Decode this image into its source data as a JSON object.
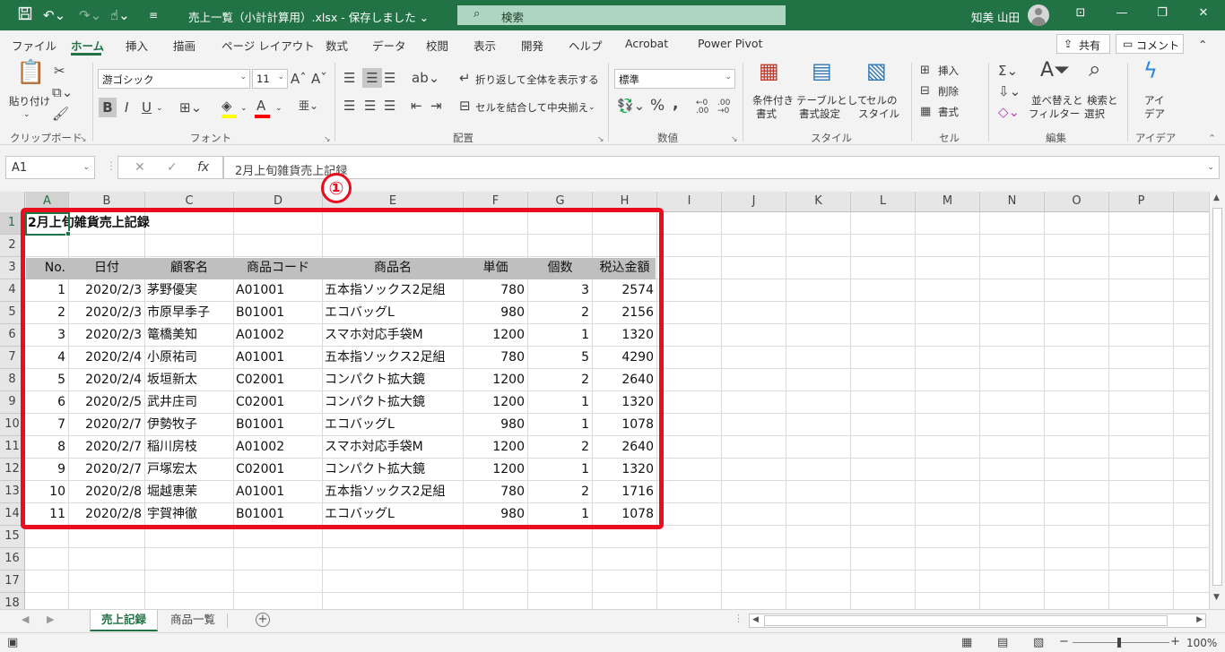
{
  "titlebar": {
    "doc_title": "売上一覧（小計計算用）.xlsx - 保存しました ⌄",
    "search_icon": "search-icon",
    "search_placeholder": "検索",
    "user_name": "知美 山田",
    "minimize_icon": "minimize-icon",
    "restore_icon": "restore-icon",
    "close_icon": "close-icon"
  },
  "menu": {
    "items": [
      "ファイル",
      "ホーム",
      "挿入",
      "描画",
      "ページ レイアウト",
      "数式",
      "データ",
      "校閲",
      "表示",
      "開発",
      "ヘルプ",
      "Acrobat",
      "Power Pivot"
    ],
    "active": "ホーム",
    "share_label": "共有",
    "comment_label": "コメント"
  },
  "ribbon": {
    "groups": [
      "クリップボード",
      "フォント",
      "配置",
      "数値",
      "スタイル",
      "セル",
      "編集",
      "アイデア"
    ],
    "paste_label": "貼り付け",
    "font_name": "游ゴシック",
    "font_size": "11",
    "wrap_text": "折り返して全体を表示する",
    "merge_center": "セルを結合して中央揃え",
    "number_format": "標準",
    "conditional_format": [
      "条件付き",
      "書式"
    ],
    "format_as_table": [
      "テーブルとして",
      "書式設定"
    ],
    "cell_styles": [
      "セルの",
      "スタイル"
    ],
    "insert_label": "挿入",
    "delete_label": "削除",
    "format_label": "書式",
    "sort_filter": [
      "並べ替えと",
      "フィルター"
    ],
    "find_select": [
      "検索と",
      "選択"
    ],
    "ideas": [
      "アイ",
      "デア"
    ]
  },
  "formula_bar": {
    "name_box": "A1",
    "fx_label": "fx",
    "content": "2月上旬雑貨売上記録"
  },
  "columns": [
    "A",
    "B",
    "C",
    "D",
    "E",
    "F",
    "G",
    "H",
    "I",
    "J",
    "K",
    "L",
    "M",
    "N",
    "O",
    "P"
  ],
  "rows": [
    "1",
    "2",
    "3",
    "4",
    "5",
    "6",
    "7",
    "8",
    "9",
    "10",
    "11",
    "12",
    "13",
    "14",
    "15",
    "16",
    "17",
    "18"
  ],
  "sheet": {
    "title": "2月上旬雑貨売上記録",
    "headers": [
      "No.",
      "日付",
      "顧客名",
      "商品コード",
      "商品名",
      "単価",
      "個数",
      "税込金額"
    ],
    "records": [
      [
        "1",
        "2020/2/3",
        "茅野優実",
        "A01001",
        "五本指ソックス2足組",
        "780",
        "3",
        "2574"
      ],
      [
        "2",
        "2020/2/3",
        "市原早季子",
        "B01001",
        "エコバッグL",
        "980",
        "2",
        "2156"
      ],
      [
        "3",
        "2020/2/3",
        "篭橋美知",
        "A01002",
        "スマホ対応手袋M",
        "1200",
        "1",
        "1320"
      ],
      [
        "4",
        "2020/2/4",
        "小原祐司",
        "A01001",
        "五本指ソックス2足組",
        "780",
        "5",
        "4290"
      ],
      [
        "5",
        "2020/2/4",
        "坂垣新太",
        "C02001",
        "コンパクト拡大鏡",
        "1200",
        "2",
        "2640"
      ],
      [
        "6",
        "2020/2/5",
        "武井庄司",
        "C02001",
        "コンパクト拡大鏡",
        "1200",
        "1",
        "1320"
      ],
      [
        "7",
        "2020/2/7",
        "伊勢牧子",
        "B01001",
        "エコバッグL",
        "980",
        "1",
        "1078"
      ],
      [
        "8",
        "2020/2/7",
        "稲川房枝",
        "A01002",
        "スマホ対応手袋M",
        "1200",
        "2",
        "2640"
      ],
      [
        "9",
        "2020/2/7",
        "戸塚宏太",
        "C02001",
        "コンパクト拡大鏡",
        "1200",
        "1",
        "1320"
      ],
      [
        "10",
        "2020/2/8",
        "堀越恵茉",
        "A01001",
        "五本指ソックス2足組",
        "780",
        "2",
        "1716"
      ],
      [
        "11",
        "2020/2/8",
        "宇賀神徹",
        "B01001",
        "エコバッグL",
        "980",
        "1",
        "1078"
      ]
    ]
  },
  "annotation": {
    "marker": "①",
    "color": "#EA0D1D"
  },
  "tabs": [
    "売上記録",
    "商品一覧"
  ],
  "active_tab": "売上記録",
  "status": {
    "zoom": "100%"
  },
  "colors": {
    "excel_green": "#217346",
    "header_fill": "#BFBFBF"
  }
}
